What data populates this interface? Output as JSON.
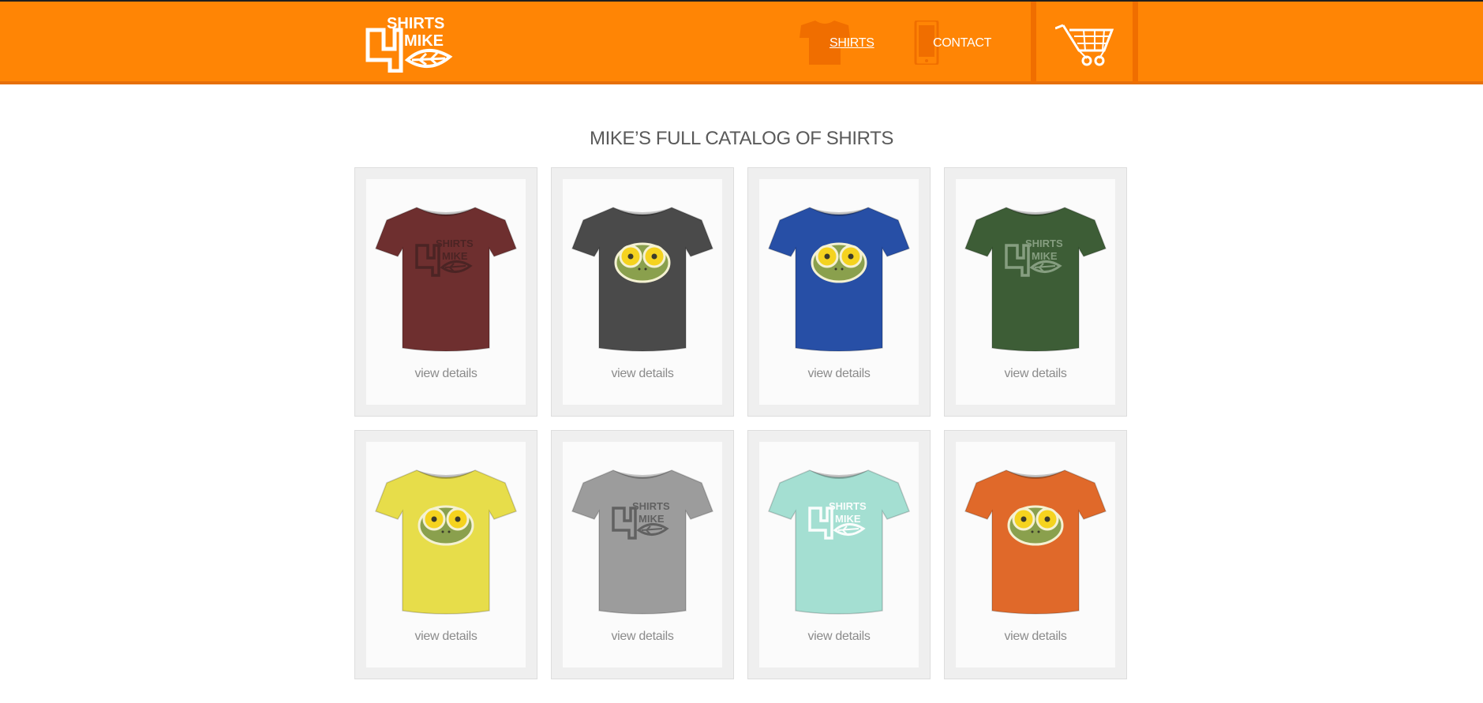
{
  "header": {
    "logo": {
      "text": "SHIRTS 4 MIKE",
      "icon": "shirts4mike-logo"
    },
    "nav": [
      {
        "label": "SHIRTS",
        "icon": "tshirt-icon",
        "active": true
      },
      {
        "label": "CONTACT",
        "icon": "phone-icon",
        "active": false
      }
    ],
    "cart": {
      "icon": "shopping-cart-icon"
    },
    "colors": {
      "background": "#ff8505",
      "accent_dark": "#f06e00"
    }
  },
  "main": {
    "title": "MIKE’S FULL CATALOG OF SHIRTS",
    "products": [
      {
        "color": "#6e2f2f",
        "design": "logo",
        "design_color": "#4a2424",
        "link_label": "view details"
      },
      {
        "color": "#4a4a4a",
        "design": "frog",
        "design_color": "",
        "link_label": "view details"
      },
      {
        "color": "#274fa6",
        "design": "frog",
        "design_color": "",
        "link_label": "view details"
      },
      {
        "color": "#3d5d36",
        "design": "logo",
        "design_color": "#8aa285",
        "link_label": "view details"
      },
      {
        "color": "#e7dd4a",
        "design": "frog",
        "design_color": "",
        "link_label": "view details"
      },
      {
        "color": "#9c9c9c",
        "design": "logo",
        "design_color": "#5e5e5e",
        "link_label": "view details"
      },
      {
        "color": "#a4dfd2",
        "design": "logo",
        "design_color": "#ffffff",
        "link_label": "view details"
      },
      {
        "color": "#e0692a",
        "design": "frog",
        "design_color": "",
        "link_label": "view details"
      }
    ]
  }
}
